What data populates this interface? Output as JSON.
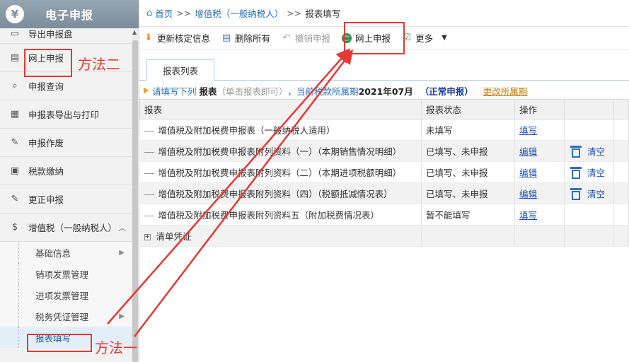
{
  "app": {
    "title": "电子申报",
    "logo_symbol": "¥"
  },
  "sidebar": {
    "items": [
      {
        "label": "导出申报盘",
        "icon": "export-disk-icon"
      },
      {
        "label": "网上申报",
        "icon": "declare-doc-icon"
      },
      {
        "label": "申报查询",
        "icon": "search-doc-icon"
      },
      {
        "label": "申报表导出与打印",
        "icon": "table-icon"
      },
      {
        "label": "申报作废",
        "icon": "edit-icon"
      },
      {
        "label": "税款缴纳",
        "icon": "wallet-icon"
      },
      {
        "label": "更正申报",
        "icon": "edit-doc-icon"
      },
      {
        "label": "增值税（一般纳税人）",
        "icon": "dollar-icon",
        "expanded": true
      }
    ],
    "subitems": [
      {
        "label": "基础信息",
        "has_arrow": true
      },
      {
        "label": "销项发票管理",
        "has_arrow": false
      },
      {
        "label": "进项发票管理",
        "has_arrow": false
      },
      {
        "label": "税务凭证管理",
        "has_arrow": true
      },
      {
        "label": "报表填写",
        "has_arrow": false,
        "active": true
      }
    ]
  },
  "breadcrumb": {
    "home": "首页",
    "sep": ">>",
    "middle": "增值税（一般纳税人）",
    "current": "报表填写"
  },
  "toolbar": {
    "buttons": [
      {
        "label": "更新核定信息",
        "icon": "update-icon",
        "disabled": false
      },
      {
        "label": "删除所有",
        "icon": "delete-all-icon",
        "disabled": false
      },
      {
        "label": "撤销申报",
        "icon": "undo-icon",
        "disabled": true
      },
      {
        "label": "网上申报",
        "icon": "globe-icon",
        "disabled": false
      },
      {
        "label": "更多",
        "icon": "more-icon",
        "disabled": false,
        "dropdown": true
      }
    ]
  },
  "tabs": [
    {
      "label": "报表列表"
    }
  ],
  "notice": {
    "prefix": "请填写下列",
    "bold1": "报表",
    "hint": "（单击报表即可）",
    "period_prefix": "，当前税款所属期",
    "period": "2021年07月",
    "status": "（正常申报）",
    "change_link": "更改所属期"
  },
  "table": {
    "headers": [
      "报表",
      "报表状态",
      "操作",
      ""
    ],
    "rows": [
      {
        "name": "增值税及附加税费申报表（一般纳税人适用）",
        "status": "未填写",
        "action": "填写",
        "clear": ""
      },
      {
        "name": "增值税及附加税费申报表附列资料（一）（本期销售情况明细）",
        "status": "已填写、未申报",
        "action": "编辑",
        "clear": "清空"
      },
      {
        "name": "增值税及附加税费申报表附列资料（二）（本期进项税额明细）",
        "status": "已填写、未申报",
        "action": "编辑",
        "clear": "清空"
      },
      {
        "name": "增值税及附加税费申报表附列资料（四）（税额抵减情况表）",
        "status": "已填写、未申报",
        "action": "编辑",
        "clear": "清空"
      },
      {
        "name": "增值税及附加税费申报表附列资料五（附加税费情况表）",
        "status": "暂不能填写",
        "action": "填写",
        "clear": ""
      },
      {
        "name": "清单凭证",
        "status": "",
        "action": "",
        "clear": "",
        "group": true
      }
    ]
  },
  "annotations": {
    "method2": "方法二",
    "method1": "方法一",
    "color": "#e53935"
  }
}
